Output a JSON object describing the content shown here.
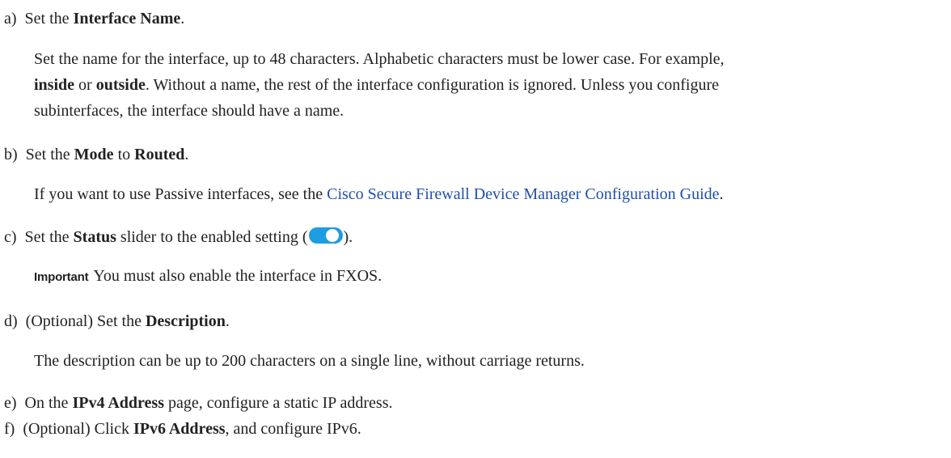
{
  "steps": {
    "a": {
      "marker": "a)",
      "pre": "Set the ",
      "bold": "Interface Name",
      "post": ".",
      "body": {
        "l1": "Set the name for the interface, up to 48 characters. Alphabetic characters must be lower case. For example,",
        "l2_b1": "inside",
        "l2_t1": " or ",
        "l2_b2": "outside",
        "l2_t2": ". Without a name, the rest of the interface configuration is ignored. Unless you configure",
        "l3": "subinterfaces, the interface should have a name."
      }
    },
    "b": {
      "marker": "b)",
      "pre": "Set the ",
      "bold1": "Mode",
      "mid": " to ",
      "bold2": "Routed",
      "post": ".",
      "body": {
        "pre": "If you want to use Passive interfaces, see the ",
        "link": "Cisco Secure Firewall Device Manager Configuration Guide",
        "post": "."
      }
    },
    "c": {
      "marker": "c)",
      "pre": "Set the ",
      "bold": "Status",
      "mid": " slider to the enabled setting (",
      "post": ").",
      "toggle_color": "#1e9de0",
      "note": {
        "label": "Important",
        "text": "You must also enable the interface in FXOS."
      }
    },
    "d": {
      "marker": "d)",
      "pre": "(Optional) Set the ",
      "bold": "Description",
      "post": ".",
      "body": "The description can be up to 200 characters on a single line, without carriage returns."
    },
    "e": {
      "marker": "e)",
      "pre": "On the ",
      "bold": "IPv4 Address",
      "post": " page, configure a static IP address."
    },
    "f": {
      "marker": "f)",
      "pre": "(Optional) Click ",
      "bold": "IPv6 Address",
      "post": ", and configure IPv6."
    }
  }
}
